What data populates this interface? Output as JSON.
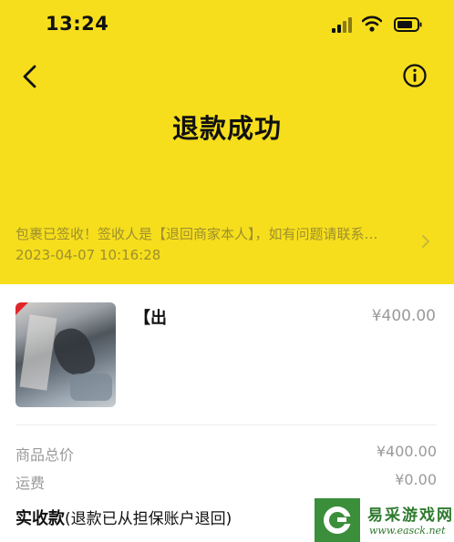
{
  "status_bar": {
    "time": "13:24"
  },
  "header": {
    "title": "退款成功"
  },
  "tracking": {
    "message": "包裹已签收！签收人是【退回商家本人】，如有问题请联系…",
    "time": "2023-04-07 10:16:28"
  },
  "product": {
    "title": "【出",
    "price": "¥400.00"
  },
  "summary": {
    "total_label": "商品总价",
    "total_value": "¥400.00",
    "shipping_label": "运费",
    "shipping_value": "¥0.00",
    "received_label": "实收款",
    "received_note": "(退款已从担保账户退回)"
  },
  "watermark": {
    "name": "易采游戏网",
    "url": "www.easck.net"
  },
  "colors": {
    "hero_yellow": "#f6de1c",
    "tracking_text": "#9d8f2e",
    "watermark_green": "#3b8e3a"
  }
}
